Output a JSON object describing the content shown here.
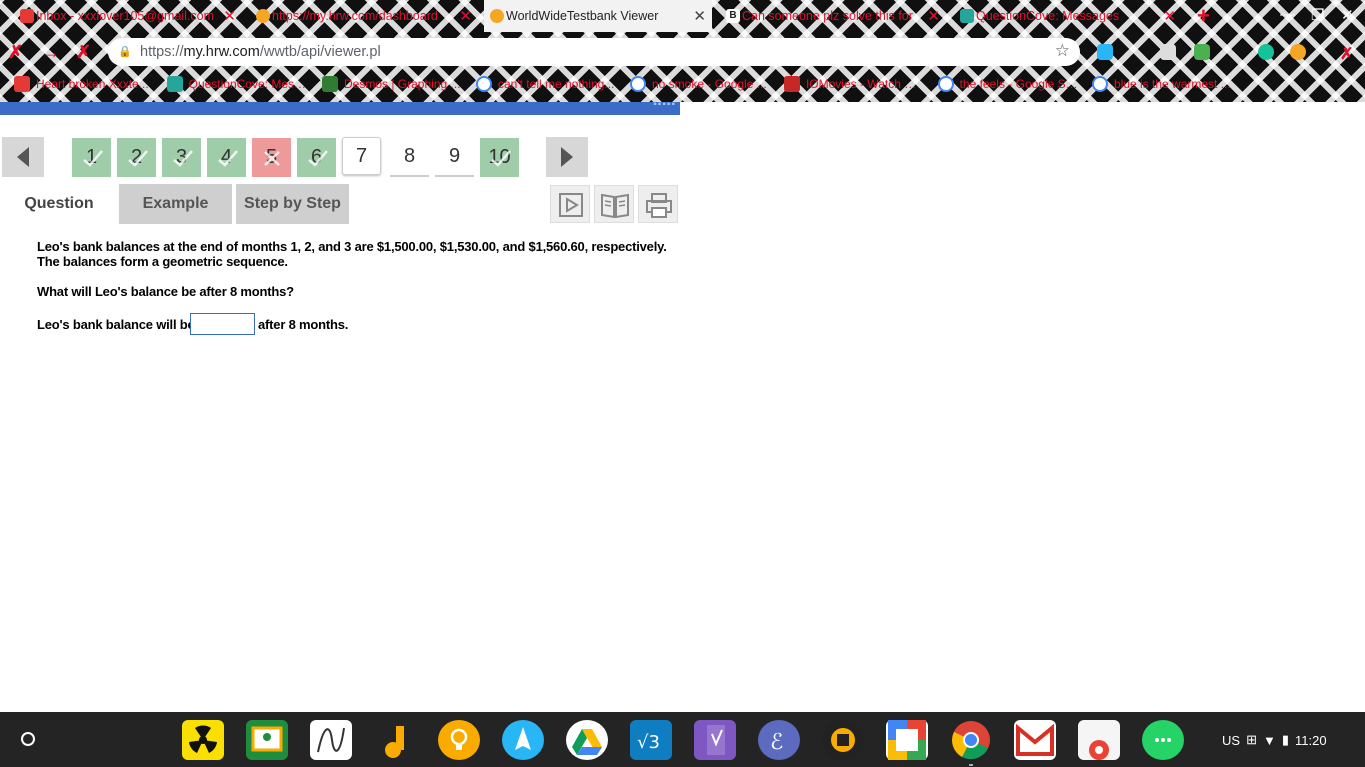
{
  "browser": {
    "tabs": [
      {
        "title": "Inbox - xxxlover105@gmail.com",
        "favicon_color": "#e53935",
        "active": false
      },
      {
        "title": "https://my.hrw.com/dashboard",
        "favicon_color": "#f5a623",
        "active": false
      },
      {
        "title": "WorldWideTestbank Viewer",
        "favicon_color": "#f5a623",
        "active": true
      },
      {
        "title": "Can someone plz solve this for",
        "favicon_color": "#222222",
        "active": false
      },
      {
        "title": "QuestionCove: Messages",
        "favicon_color": "#26a69a",
        "active": false
      }
    ],
    "new_tab": "+",
    "url_prefix": "https://",
    "url_host": "my.hrw.com",
    "url_path": "/wwtb/api/viewer.pl",
    "bookmarks": [
      {
        "label": "Heart broken Xxxte...",
        "color": "#e53935"
      },
      {
        "label": "QuestionCove: Mess...",
        "color": "#26a69a"
      },
      {
        "label": "Desmos | Graphing ...",
        "color": "#2e7d32"
      },
      {
        "label": "can't tell me nothing...",
        "color": "#4285f4"
      },
      {
        "label": "no smoke - Google ...",
        "color": "#4285f4"
      },
      {
        "label": "IOMovies - Watch M...",
        "color": "#c62828"
      },
      {
        "label": "the feels - Google Se...",
        "color": "#4285f4"
      },
      {
        "label": "blue is the warmest ...",
        "color": "#4285f4"
      }
    ]
  },
  "viewer": {
    "questions": [
      {
        "num": "1",
        "state": "done"
      },
      {
        "num": "2",
        "state": "done"
      },
      {
        "num": "3",
        "state": "done"
      },
      {
        "num": "4",
        "state": "done"
      },
      {
        "num": "5",
        "state": "wrong"
      },
      {
        "num": "6",
        "state": "done"
      },
      {
        "num": "7",
        "state": "current"
      },
      {
        "num": "8",
        "state": "plain"
      },
      {
        "num": "9",
        "state": "plain"
      },
      {
        "num": "10",
        "state": "done"
      }
    ],
    "tabs": {
      "question": "Question",
      "example": "Example",
      "step_by_step": "Step by Step"
    },
    "problem": {
      "line1": "Leo's bank balances at the end of months 1, 2, and 3 are $1,500.00, $1,530.00, and $1,560.60, respectively.",
      "line2": "The balances form a geometric sequence.",
      "question": "What will Leo's balance be after 8 months?",
      "answer_prefix": "Leo's bank balance will be $",
      "answer_value": "",
      "answer_suffix": "after 8 months."
    }
  },
  "taskbar": {
    "apps": [
      "radiation-app",
      "classroom-app",
      "graph-app",
      "music-app",
      "keep-app",
      "vector-app",
      "drive-app",
      "v3-app",
      "notebook-app",
      "e-app",
      "settings-app",
      "gallery-app",
      "chrome-app",
      "gmail-app",
      "slides-app",
      "chat-app"
    ],
    "tray": {
      "lang": "US",
      "time": "11:20"
    }
  }
}
